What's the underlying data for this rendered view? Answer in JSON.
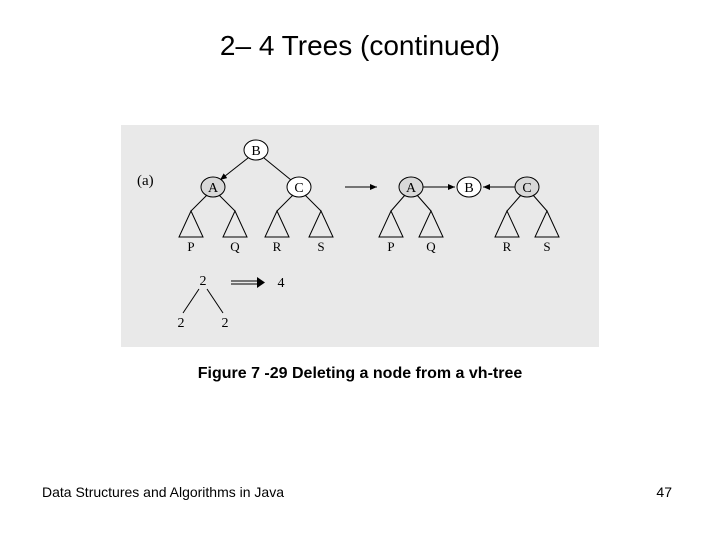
{
  "title": "2– 4 Trees (continued)",
  "figure": {
    "panel_label": "(a)",
    "left_tree": {
      "root": "B",
      "children": [
        {
          "key": "A",
          "gray": true,
          "leaves": [
            "P",
            "Q"
          ]
        },
        {
          "key": "C",
          "gray": false,
          "leaves": [
            "R",
            "S"
          ]
        }
      ]
    },
    "arrow_between": "→",
    "right_tree": {
      "roots": [
        {
          "key": "A",
          "gray": true
        },
        {
          "key": "B",
          "gray": false
        },
        {
          "key": "C",
          "gray": true
        }
      ],
      "leaves": [
        "P",
        "Q",
        "R",
        "S"
      ]
    },
    "bottom_fragment": {
      "top": "2",
      "leaves": [
        "2",
        "2"
      ],
      "arrow": "⇒",
      "result": "4"
    }
  },
  "caption": "Figure 7 -29 Deleting a node from a vh-tree",
  "footer": {
    "left": "Data Structures and Algorithms in Java",
    "page": "47"
  }
}
